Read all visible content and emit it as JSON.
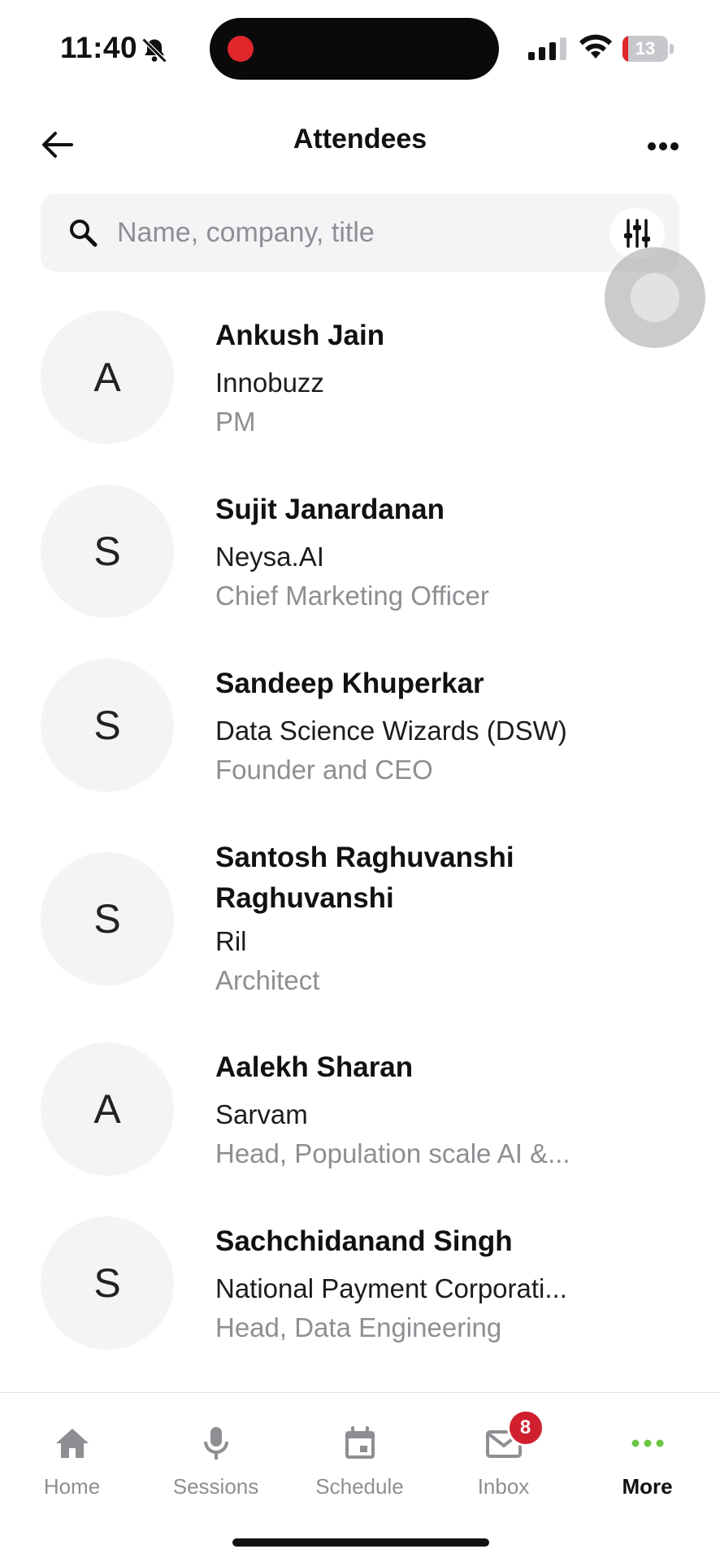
{
  "status_bar": {
    "time": "11:40",
    "battery_level": "13",
    "battery_fraction": 0.13
  },
  "header": {
    "title": "Attendees"
  },
  "search": {
    "placeholder": "Name, company, title"
  },
  "attendees": [
    {
      "initial": "A",
      "name": "Ankush  Jain",
      "company": "Innobuzz",
      "title": "PM"
    },
    {
      "initial": "S",
      "name": "Sujit  Janardanan",
      "company": "Neysa.AI",
      "title": "Chief Marketing Officer"
    },
    {
      "initial": "S",
      "name": "Sandeep  Khuperkar",
      "company": "Data Science Wizards (DSW)",
      "title": "Founder and CEO"
    },
    {
      "initial": "S",
      "name": "Santosh Raghuvanshi Raghuvanshi",
      "company": "Ril",
      "title": "Architect"
    },
    {
      "initial": "A",
      "name": "Aalekh  Sharan",
      "company": "Sarvam",
      "title": "Head, Population scale AI &..."
    },
    {
      "initial": "S",
      "name": "Sachchidanand  Singh",
      "company": "National Payment Corporati...",
      "title": "Head, Data Engineering"
    }
  ],
  "tabs": [
    {
      "label": "Home",
      "icon": "home-icon"
    },
    {
      "label": "Sessions",
      "icon": "microphone-icon"
    },
    {
      "label": "Schedule",
      "icon": "calendar-icon"
    },
    {
      "label": "Inbox",
      "icon": "mail-icon",
      "badge": "8"
    },
    {
      "label": "More",
      "icon": "more-dots-icon",
      "active": true
    }
  ],
  "colors": {
    "accent": "#6cc644",
    "badge": "#d0202e",
    "muted": "#8e8e93",
    "avatar_bg": "#f4f4f6"
  }
}
